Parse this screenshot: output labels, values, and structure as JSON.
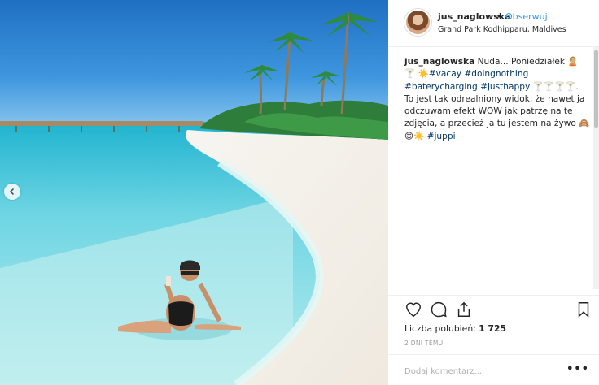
{
  "post": {
    "username": "jus_naglowska",
    "separator": "•",
    "follow_label": "Obserwuj",
    "location": "Grand Park Kodhipparu, Maldives"
  },
  "caption": {
    "user": "jus_naglowska",
    "t1": "Nuda... Poniedziałek 🙎🏼 🍸",
    "t2": "☀️",
    "tag_vacay": "#vacay",
    "tag_doingnothing": "#doingnothing",
    "tag_batery": "#baterycharging",
    "tag_justhappy": "#justhappy",
    "t3": "🍸🍸🍸🍸. To jest tak odrealniony widok, że nawet ja odczuwam efekt WOW jak patrzę na te zdjęcia, a przecież ja tu jestem na żywo 🙈",
    "t4": "😊☀️",
    "tag_juppi": "#juppi"
  },
  "engagement": {
    "likes_label": "Liczba polubień:",
    "likes_count": "1 725",
    "time": "2 DNI TEMU"
  },
  "comment": {
    "placeholder": "Dodaj komentarz...",
    "more": "•••"
  },
  "icons": {
    "like": "heart-icon",
    "comment": "comment-icon",
    "share": "share-icon",
    "save": "bookmark-icon",
    "prev": "chevron-left-icon"
  },
  "colors": {
    "link": "#3897f0",
    "hashtag": "#003569"
  }
}
